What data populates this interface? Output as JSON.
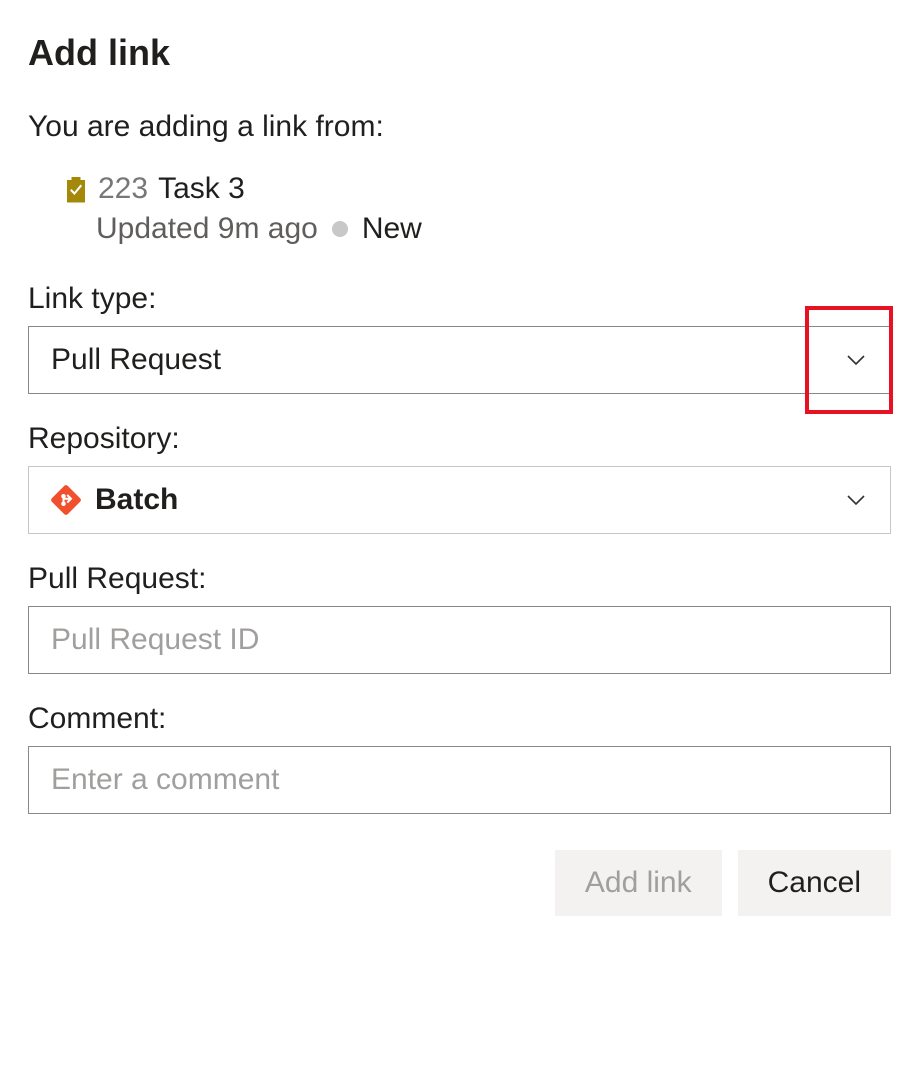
{
  "dialog": {
    "title": "Add link",
    "intro": "You are adding a link from:"
  },
  "workItem": {
    "id": "223",
    "title": "Task 3",
    "updated": "Updated 9m ago",
    "state": "New"
  },
  "fields": {
    "linkType": {
      "label": "Link type:",
      "selected": "Pull Request"
    },
    "repository": {
      "label": "Repository:",
      "selected": "Batch"
    },
    "pullRequest": {
      "label": "Pull Request:",
      "placeholder": "Pull Request ID"
    },
    "comment": {
      "label": "Comment:",
      "placeholder": "Enter a comment"
    }
  },
  "buttons": {
    "submit": "Add link",
    "cancel": "Cancel"
  }
}
